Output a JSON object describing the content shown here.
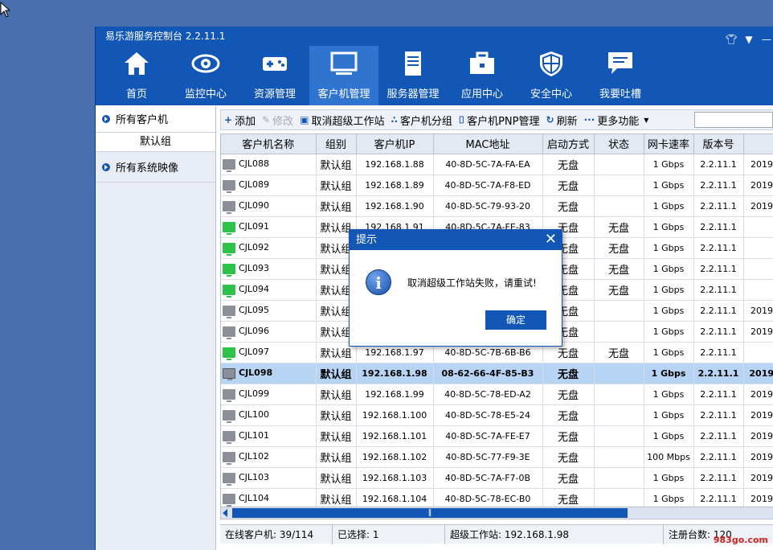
{
  "window": {
    "title": "易乐游服务控制台 2.2.11.1"
  },
  "nav": [
    {
      "label": "首页",
      "icon": "home-icon"
    },
    {
      "label": "监控中心",
      "icon": "eye-icon"
    },
    {
      "label": "资源管理",
      "icon": "gamepad-icon"
    },
    {
      "label": "客户机管理",
      "icon": "monitor-icon",
      "active": true
    },
    {
      "label": "服务器管理",
      "icon": "server-icon"
    },
    {
      "label": "应用中心",
      "icon": "toolbox-icon"
    },
    {
      "label": "安全中心",
      "icon": "shield-icon"
    },
    {
      "label": "我要吐槽",
      "icon": "chat-icon"
    }
  ],
  "sidebar": {
    "all_clients": "所有客户机",
    "default_group": "默认组",
    "system_images": "所有系统映像"
  },
  "toolbar": {
    "add": "添加",
    "edit": "修改",
    "cancel_super": "取消超级工作站",
    "group": "客户机分组",
    "pnp": "客户机PNP管理",
    "refresh": "刷新",
    "more": "更多功能"
  },
  "table": {
    "headers": [
      "客户机名称",
      "组别",
      "客户机IP",
      "MAC地址",
      "启动方式",
      "状态",
      "网卡速率",
      "版本号",
      ""
    ],
    "rows": [
      {
        "name": "CJL088",
        "group": "默认组",
        "ip": "192.168.1.88",
        "mac": "40-8D-5C-7A-FA-EA",
        "boot": "无盘",
        "status": "",
        "speed": "1 Gbps",
        "ver": "2.2.11.1",
        "date": "2019-",
        "icon": "off"
      },
      {
        "name": "CJL089",
        "group": "默认组",
        "ip": "192.168.1.89",
        "mac": "40-8D-5C-7A-F8-ED",
        "boot": "无盘",
        "status": "",
        "speed": "1 Gbps",
        "ver": "2.2.11.1",
        "date": "2019-",
        "icon": "off"
      },
      {
        "name": "CJL090",
        "group": "默认组",
        "ip": "192.168.1.90",
        "mac": "40-8D-5C-79-93-20",
        "boot": "无盘",
        "status": "",
        "speed": "1 Gbps",
        "ver": "2.2.11.1",
        "date": "2019-",
        "icon": "off"
      },
      {
        "name": "CJL091",
        "group": "默认组",
        "ip": "192.168.1.91",
        "mac": "40-8D-5C-7A-FE-83",
        "boot": "无盘",
        "status": "无盘",
        "speed": "1 Gbps",
        "ver": "2.2.11.1",
        "date": "",
        "icon": "on"
      },
      {
        "name": "CJL092",
        "group": "默认组",
        "ip": "",
        "mac": "",
        "boot": "无盘",
        "status": "无盘",
        "speed": "1 Gbps",
        "ver": "2.2.11.1",
        "date": "",
        "icon": "on"
      },
      {
        "name": "CJL093",
        "group": "默认组",
        "ip": "",
        "mac": "",
        "boot": "无盘",
        "status": "无盘",
        "speed": "1 Gbps",
        "ver": "2.2.11.1",
        "date": "",
        "icon": "on"
      },
      {
        "name": "CJL094",
        "group": "默认组",
        "ip": "",
        "mac": "",
        "boot": "无盘",
        "status": "无盘",
        "speed": "1 Gbps",
        "ver": "2.2.11.1",
        "date": "",
        "icon": "on"
      },
      {
        "name": "CJL095",
        "group": "默认组",
        "ip": "",
        "mac": "",
        "boot": "无盘",
        "status": "",
        "speed": "1 Gbps",
        "ver": "2.2.11.1",
        "date": "2019-",
        "icon": "off"
      },
      {
        "name": "CJL096",
        "group": "默认组",
        "ip": "",
        "mac": "",
        "boot": "无盘",
        "status": "",
        "speed": "1 Gbps",
        "ver": "2.2.11.1",
        "date": "2019-",
        "icon": "off"
      },
      {
        "name": "CJL097",
        "group": "默认组",
        "ip": "192.168.1.97",
        "mac": "40-8D-5C-7B-6B-B6",
        "boot": "无盘",
        "status": "无盘",
        "speed": "1 Gbps",
        "ver": "2.2.11.1",
        "date": "",
        "icon": "on"
      },
      {
        "name": "CJL098",
        "group": "默认组",
        "ip": "192.168.1.98",
        "mac": "08-62-66-4F-85-B3",
        "boot": "无盘",
        "status": "",
        "speed": "1 Gbps",
        "ver": "2.2.11.1",
        "date": "2019-",
        "icon": "sv",
        "selected": true
      },
      {
        "name": "CJL099",
        "group": "默认组",
        "ip": "192.168.1.99",
        "mac": "40-8D-5C-78-ED-A2",
        "boot": "无盘",
        "status": "",
        "speed": "1 Gbps",
        "ver": "2.2.11.1",
        "date": "2019-",
        "icon": "off"
      },
      {
        "name": "CJL100",
        "group": "默认组",
        "ip": "192.168.1.100",
        "mac": "40-8D-5C-78-E5-24",
        "boot": "无盘",
        "status": "",
        "speed": "1 Gbps",
        "ver": "2.2.11.1",
        "date": "2019-",
        "icon": "off"
      },
      {
        "name": "CJL101",
        "group": "默认组",
        "ip": "192.168.1.101",
        "mac": "40-8D-5C-7A-FE-E7",
        "boot": "无盘",
        "status": "",
        "speed": "1 Gbps",
        "ver": "2.2.11.1",
        "date": "2019-",
        "icon": "off"
      },
      {
        "name": "CJL102",
        "group": "默认组",
        "ip": "192.168.1.102",
        "mac": "40-8D-5C-77-F9-3E",
        "boot": "无盘",
        "status": "",
        "speed": "100 Mbps",
        "ver": "2.2.11.1",
        "date": "2019-",
        "icon": "off"
      },
      {
        "name": "CJL103",
        "group": "默认组",
        "ip": "192.168.1.103",
        "mac": "40-8D-5C-7A-F7-0B",
        "boot": "无盘",
        "status": "",
        "speed": "1 Gbps",
        "ver": "2.2.11.1",
        "date": "2019-",
        "icon": "off"
      },
      {
        "name": "CJL104",
        "group": "默认组",
        "ip": "192.168.1.104",
        "mac": "40-8D-5C-78-EC-B0",
        "boot": "无盘",
        "status": "",
        "speed": "1 Gbps",
        "ver": "2.2.11.1",
        "date": "2019-",
        "icon": "off"
      }
    ]
  },
  "status": {
    "online": "在线客户机: 39/114",
    "selected": "已选择: 1",
    "super": "超级工作站: 192.168.1.98",
    "registered": "注册台数: 120"
  },
  "dialog": {
    "title": "提示",
    "message": "取消超级工作站失败，请重试!",
    "ok": "确定"
  },
  "watermark": "983go.com",
  "colors": {
    "primary": "#1257b5",
    "active_nav": "#2f75cf",
    "online": "#2ec24a",
    "selected_row": "#b8d4f4"
  }
}
